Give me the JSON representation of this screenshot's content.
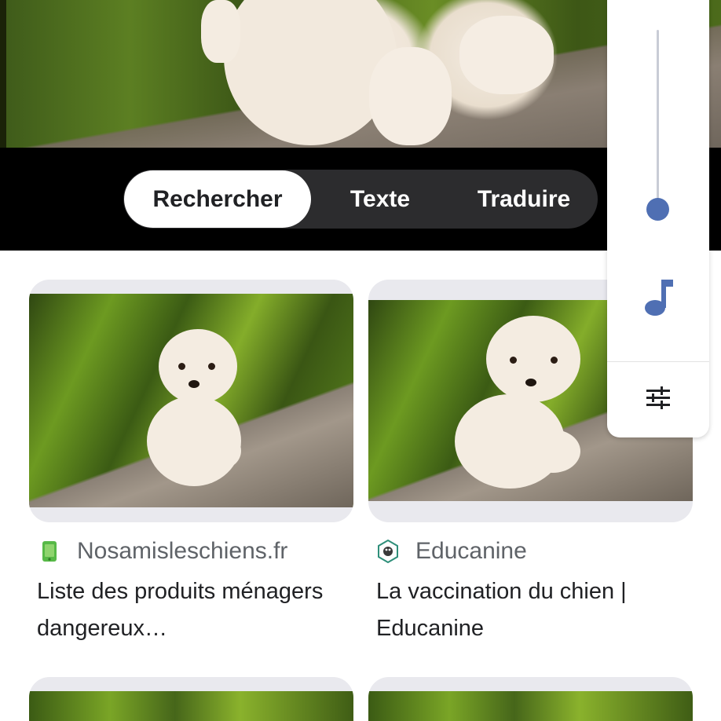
{
  "lens_tabs": {
    "search_label": "Rechercher",
    "text_label": "Texte",
    "translate_label": "Traduire",
    "selected": "Rechercher"
  },
  "volume_panel": {
    "level": 0.0,
    "mode_icon": "music-note-icon",
    "settings_icon": "tune-icon"
  },
  "results": [
    {
      "source": "Nosamisleschiens.fr",
      "source_icon": "green-phone-logo-icon",
      "title": "Liste des produits ménagers dangereux…"
    },
    {
      "source": "Educanine",
      "source_icon": "dog-badge-logo-icon",
      "title": "La vaccination du chien | Educanine"
    }
  ],
  "colors": {
    "accent": "#4f6fb3",
    "segmented_bg": "#2c2c2e",
    "text_primary": "#202124",
    "text_secondary": "#5f6368"
  }
}
